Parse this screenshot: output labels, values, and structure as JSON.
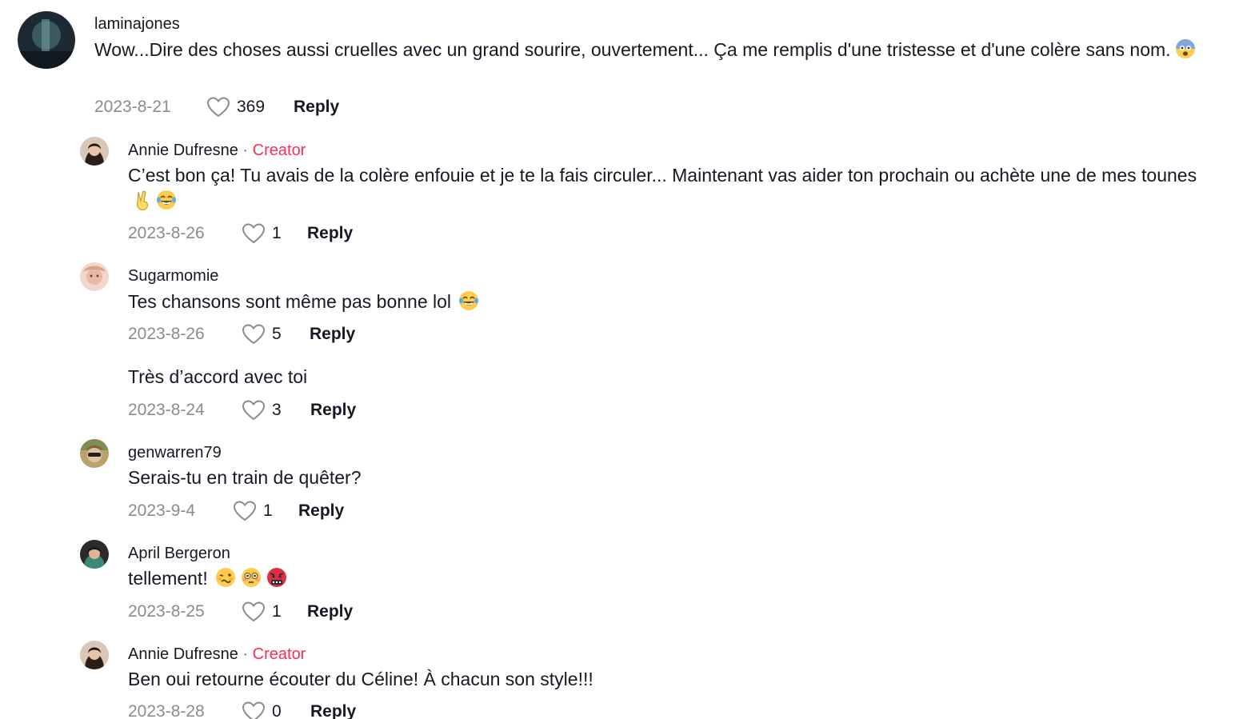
{
  "comments": [
    {
      "username": "laminajones",
      "text": "Wow...Dire des choses aussi cruelles avec un grand sourire, ouvertement... Ça me remplis d'une tristesse et d'une colère sans nom.",
      "emojis": [
        "fearful-face-emoji"
      ],
      "date": "2023-8-21",
      "likes": "369",
      "reply_label": "Reply"
    },
    {
      "username": "Annie Dufresne",
      "separator": " · ",
      "badge": "Creator",
      "text": "C’est bon ça! Tu avais de la colère enfouie et je te la fais circuler... Maintenant vas aider ton prochain ou achète une de mes tounes",
      "emojis": [
        "victory-hand-emoji",
        "laughing-tears-emoji"
      ],
      "date": "2023-8-26",
      "likes": "1",
      "reply_label": "Reply"
    },
    {
      "username": "Sugarmomie",
      "text": "Tes chansons sont même pas bonne lol",
      "emojis": [
        "laughing-tears-emoji"
      ],
      "date": "2023-8-26",
      "likes": "5",
      "reply_label": "Reply"
    },
    {
      "username": "",
      "text": "Très d’accord avec toi",
      "date": "2023-8-24",
      "likes": "3",
      "reply_label": "Reply"
    },
    {
      "username": "genwarren79",
      "text": "Serais-tu en train de quêter?",
      "date": "2023-9-4",
      "likes": "1",
      "reply_label": "Reply"
    },
    {
      "username": "April Bergeron",
      "text": "tellement!",
      "emojis": [
        "woozy-face-emoji",
        "flushed-face-emoji",
        "cursing-face-emoji"
      ],
      "date": "2023-8-25",
      "likes": "1",
      "reply_label": "Reply"
    },
    {
      "username": "Annie Dufresne",
      "separator": " · ",
      "badge": "Creator",
      "text": "Ben oui retourne écouter du Céline! À chacun son style!!!",
      "date": "2023-8-28",
      "likes": "0",
      "reply_label": "Reply"
    }
  ],
  "colors": {
    "creator_badge": "#fe2c55",
    "date": "#8a8b91",
    "text": "#161823"
  }
}
